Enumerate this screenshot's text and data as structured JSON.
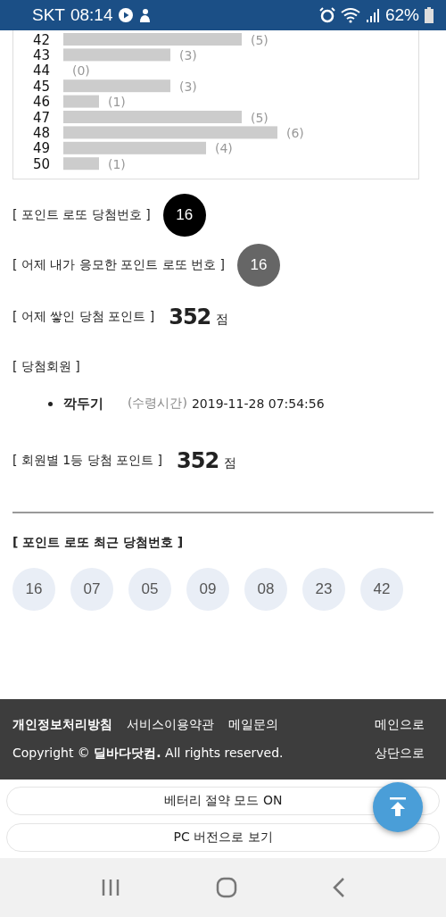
{
  "status_bar": {
    "carrier": "SKT",
    "time": "08:14",
    "battery": "62%"
  },
  "chart": {
    "chart_data": {
      "type": "bar",
      "orientation": "horizontal",
      "categories": [
        "42",
        "43",
        "44",
        "45",
        "46",
        "47",
        "48",
        "49",
        "50"
      ],
      "values": [
        5,
        3,
        0,
        3,
        1,
        5,
        6,
        4,
        1
      ],
      "value_labels": [
        "(5)",
        "(3)",
        "(0)",
        "(3)",
        "(1)",
        "(5)",
        "(6)",
        "(4)",
        "(1)"
      ]
    }
  },
  "sections": [
    {
      "kind": "ball",
      "label": "[ 포인트 로또 당첨번호 ]",
      "number": "16",
      "color": "#000000"
    },
    {
      "kind": "ball",
      "label": "[ 어제 내가 응모한 포인트 로또 번호 ]",
      "number": "16",
      "color": "#666666"
    },
    {
      "kind": "points",
      "label": "[ 어제 쌓인 당첨 포인트 ]",
      "value": "352",
      "unit": "점"
    },
    {
      "kind": "heading",
      "label": "[ 당첨회원 ]"
    },
    {
      "kind": "member",
      "name": "깍두기",
      "time_label": "(수령시간)",
      "time": "2019-11-28 07:54:56"
    },
    {
      "kind": "points",
      "label": "[ 회원별 1등 당첨 포인트 ]",
      "value": "352",
      "unit": "점"
    }
  ],
  "recent": {
    "title": "[ 포인트 로또 최근 당첨번호 ]",
    "numbers": [
      "16",
      "07",
      "05",
      "09",
      "08",
      "23",
      "42"
    ]
  },
  "footer": {
    "links": [
      "개인정보처리방침",
      "서비스이용약관",
      "메일문의"
    ],
    "copyright": "Copyright © **딜바다닷컴.** All rights reserved.",
    "side_links": [
      "메인으로",
      "상단으로"
    ]
  },
  "buttons": [
    "베터리 절약 모드 ON",
    "PC 버전으로 보기"
  ]
}
